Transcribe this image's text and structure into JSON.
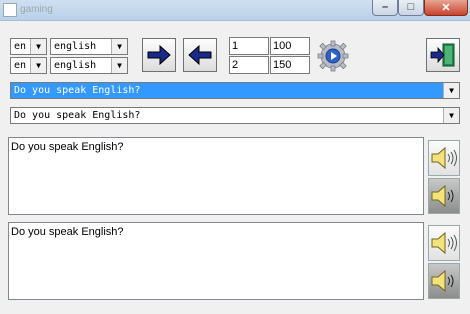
{
  "window": {
    "title": "gaming"
  },
  "titlebar": {
    "min": "–",
    "max": "□",
    "close": "✕"
  },
  "lang": {
    "row1": {
      "code": "en",
      "name": "english"
    },
    "row2": {
      "code": "en",
      "name": "english"
    }
  },
  "numbers": {
    "a1": "1",
    "b1": "100",
    "a2": "2",
    "b2": "150"
  },
  "phrases": {
    "selected": "Do you speak English?",
    "second": "Do you speak English?"
  },
  "text": {
    "source": "Do you speak English?",
    "target": "Do you speak English?"
  },
  "icons": {
    "translate_forward": "arrow-right-icon",
    "translate_back": "arrow-left-icon",
    "settings": "gear-play-icon",
    "exit": "exit-door-icon",
    "speak": "speaker-icon",
    "speak_slow": "speaker-slow-icon"
  }
}
